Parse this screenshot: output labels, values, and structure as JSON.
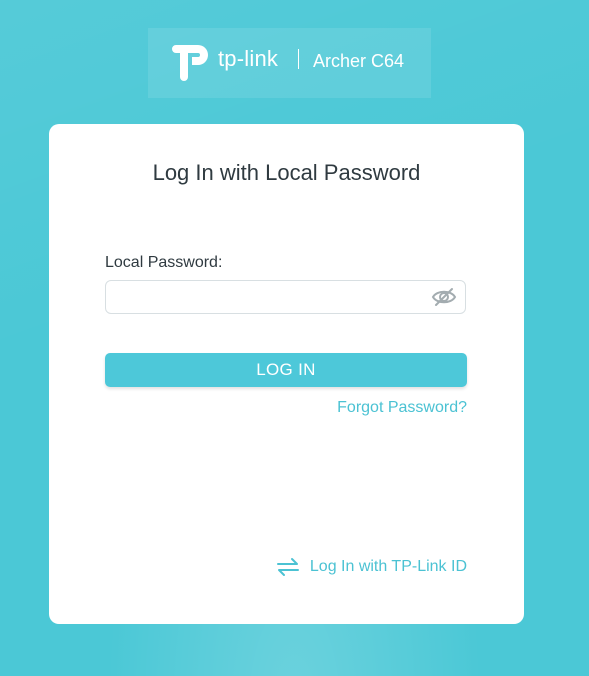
{
  "brand": {
    "name": "tp-link",
    "model": "Archer C64"
  },
  "card": {
    "title": "Log In with Local Password",
    "password_label": "Local Password:",
    "password_value": "",
    "password_placeholder": "",
    "login_label": "LOG IN",
    "forgot_label": "Forgot Password?",
    "tplink_id_label": "Log In with TP-Link ID"
  },
  "icons": {
    "logo": "tp-link-logo",
    "eye": "eye-off-icon",
    "switch": "switch-arrows-icon"
  },
  "colors": {
    "background": "#4bc8d6",
    "accent": "#4dc8d9",
    "link": "#4bc2d3",
    "text": "#2f3a40"
  }
}
